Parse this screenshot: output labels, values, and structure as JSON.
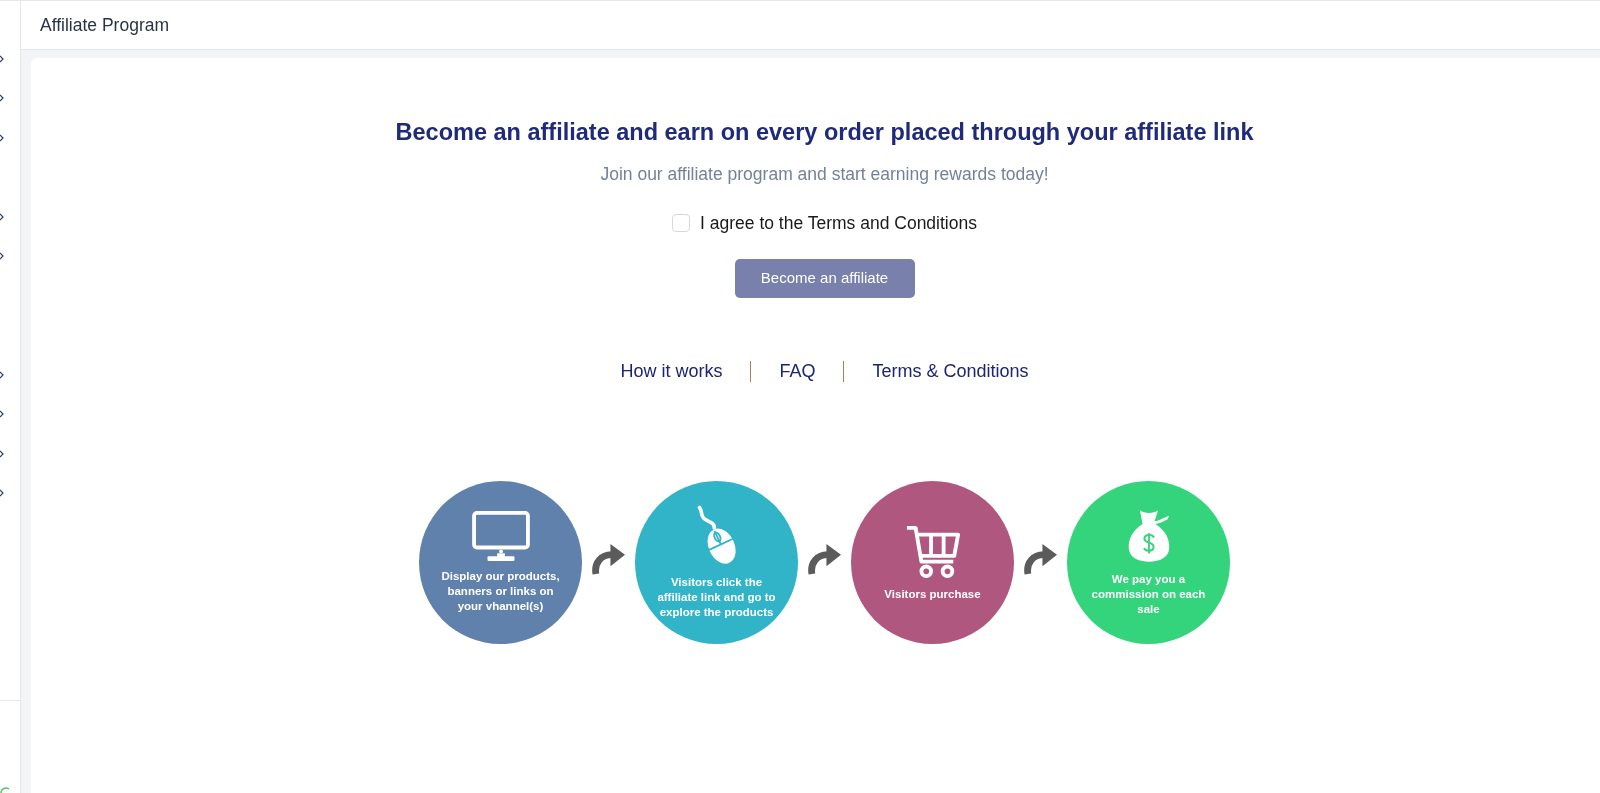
{
  "header": {
    "title": "Affiliate Program"
  },
  "hero": {
    "title": "Become an affiliate and earn on every order placed through your affiliate link",
    "subtitle": "Join our affiliate program and start earning rewards today!",
    "agreement": {
      "label": "I agree to the Terms and Conditions",
      "checked": false
    },
    "button": {
      "label": "Become an affiliate",
      "disabled": true
    }
  },
  "links": [
    {
      "label": "How it works"
    },
    {
      "label": "FAQ"
    },
    {
      "label": "Terms & Conditions"
    }
  ],
  "steps": [
    {
      "kind": "monitor",
      "text": "Display our products, banners or links on your vhannel(s)",
      "color": "#6081ac"
    },
    {
      "kind": "mouse",
      "text": "Visitors click the affiliate link and go to explore the products",
      "color": "#31b3c8"
    },
    {
      "kind": "cart",
      "text": "Visitors purchase",
      "color": "#b0577f"
    },
    {
      "kind": "bag",
      "text": "We pay you a commission on each sale",
      "color": "#33d47b"
    }
  ]
}
